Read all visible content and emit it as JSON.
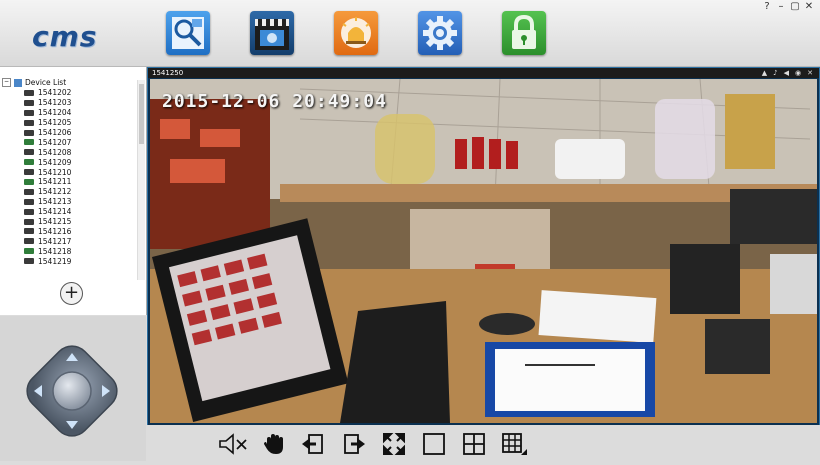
{
  "app": {
    "logo": "cms"
  },
  "window_controls": {
    "help": "?",
    "minimize": "–",
    "restore": "▢",
    "close": "✕"
  },
  "toolbar": {
    "buttons": [
      {
        "name": "search-devices",
        "icon": "magnifier-icon",
        "color": "#2b7fd6"
      },
      {
        "name": "playback",
        "icon": "clapperboard-icon",
        "color": "#1c4f86"
      },
      {
        "name": "alarm",
        "icon": "siren-icon",
        "color": "#ef7c1e"
      },
      {
        "name": "settings",
        "icon": "gear-icon",
        "color": "#2f6ec8"
      },
      {
        "name": "lock",
        "icon": "padlock-icon",
        "color": "#39a73a"
      }
    ]
  },
  "device_tree": {
    "root_label": "Device List",
    "devices": [
      "1541202",
      "1541203",
      "1541204",
      "1541205",
      "1541206",
      "1541207",
      "1541208",
      "1541209",
      "1541210",
      "1541211",
      "1541212",
      "1541213",
      "1541214",
      "1541215",
      "1541216",
      "1541217",
      "1541218",
      "1541219"
    ],
    "add_label": "+"
  },
  "video": {
    "channel_label": "1541250",
    "osd_timestamp": "2015-12-06 20:49:04"
  },
  "colors": {
    "frame_border": "#2b6fa1",
    "accent": "#1f4f8f"
  }
}
